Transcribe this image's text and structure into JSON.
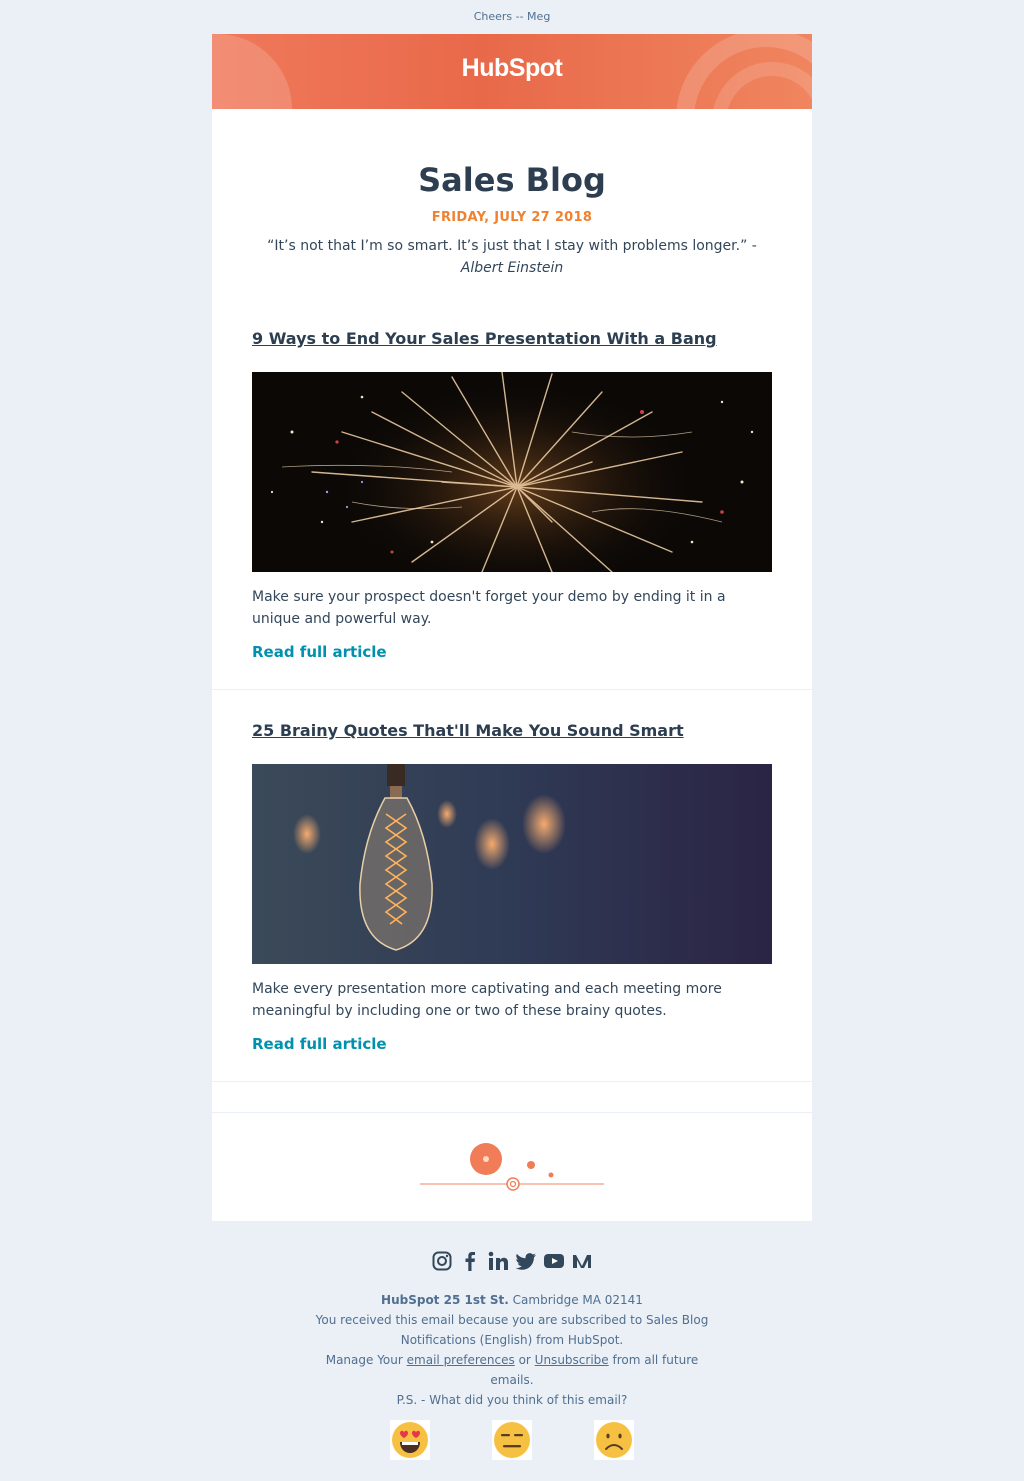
{
  "preheader": "Cheers -- Meg",
  "brand": {
    "logo_text": "HubSpot",
    "accent": "#f0795b",
    "date_color": "#f0822f",
    "link_color": "#0091ae"
  },
  "header": {
    "title": "Sales Blog",
    "date": "FRIDAY, JULY 27 2018",
    "quote": "“It’s not that I’m so smart. It’s just that I stay with problems longer.” -",
    "quote_author": "Albert Einstein"
  },
  "articles": [
    {
      "title": "9 Ways to End Your Sales Presentation With a Bang",
      "image": "fireworks-image",
      "description": "Make sure your prospect doesn't forget your demo by ending it in a unique and powerful way.",
      "cta": "Read full article"
    },
    {
      "title": "25 Brainy Quotes That'll Make You Sound Smart",
      "image": "lightbulb-image",
      "description": "Make every presentation more captivating and each meeting more meaningful by including one or two of these brainy quotes.",
      "cta": "Read full article"
    }
  ],
  "footer": {
    "socials": [
      "instagram-icon",
      "facebook-icon",
      "linkedin-icon",
      "twitter-icon",
      "youtube-icon",
      "medium-icon"
    ],
    "company": "HubSpot 25 1st St.",
    "address": "Cambridge MA 02141",
    "subscribed_text": "You received this email because you are subscribed to Sales Blog Notifications (English) from HubSpot.",
    "manage_prefix": "Manage Your",
    "preferences_link": "email preferences",
    "or_text": "or",
    "unsubscribe_link": "Unsubscribe",
    "manage_suffix": "from all future emails.",
    "ps": "P.S. - What did you think of this email?",
    "feedback": [
      "heart-eyes-emoji",
      "neutral-face-emoji",
      "frowning-face-emoji"
    ]
  }
}
